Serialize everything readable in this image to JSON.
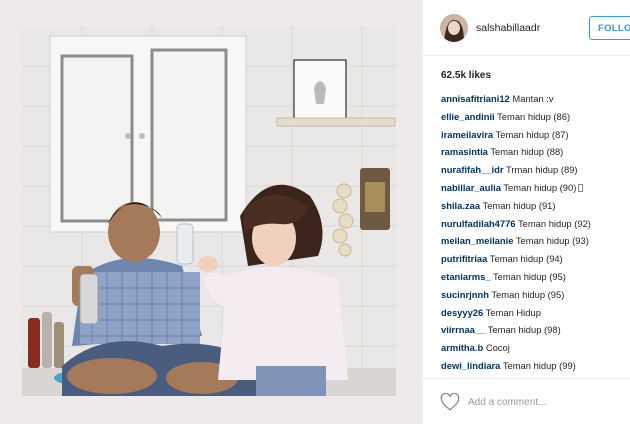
{
  "post": {
    "username": "salshabillaadr",
    "follow_label": "FOLLOW",
    "likes": "62.5k likes",
    "comment_placeholder": "Add a comment...",
    "comments": [
      {
        "user": "annisafitriani12",
        "text": "Mantan :v"
      },
      {
        "user": "ellie_andinii",
        "text": "Teman hidup (86)"
      },
      {
        "user": "irameilavira",
        "text": "Teman hidup (87)"
      },
      {
        "user": "ramasintia",
        "text": "Teman hidup (88)"
      },
      {
        "user": "nurafifah__idr",
        "text": "Trman hidup (89)"
      },
      {
        "user": "nabillar_aulia",
        "text": "Teman hidup (90)"
      },
      {
        "user": "shila.zaa",
        "text": "Teman hidup (91)"
      },
      {
        "user": "nurulfadilah4776",
        "text": "Teman hidup (92)"
      },
      {
        "user": "meilan_meilanie",
        "text": "Teman hidup (93)"
      },
      {
        "user": "putrifitriaa",
        "text": "Teman hidup (94)"
      },
      {
        "user": "etaniarms_",
        "text": "Teman hidup (95)"
      },
      {
        "user": "sucinrjnnh",
        "text": "Teman hidup (95)"
      },
      {
        "user": "desyyy26",
        "text": "Teman Hidup"
      },
      {
        "user": "viirrnaa__",
        "text": "Teman hidup (98)"
      },
      {
        "user": "armitha.b",
        "text": "Cocoj"
      },
      {
        "user": "dewi_lindiara",
        "text": "Teman hidup (99)"
      }
    ]
  },
  "icons": {
    "heart": "heart-icon",
    "avatar": "avatar",
    "photo": "photo"
  },
  "colors": {
    "link": "#003569",
    "accent": "#3897f0",
    "text": "#262626",
    "muted": "#999999",
    "border": "#efefef"
  }
}
